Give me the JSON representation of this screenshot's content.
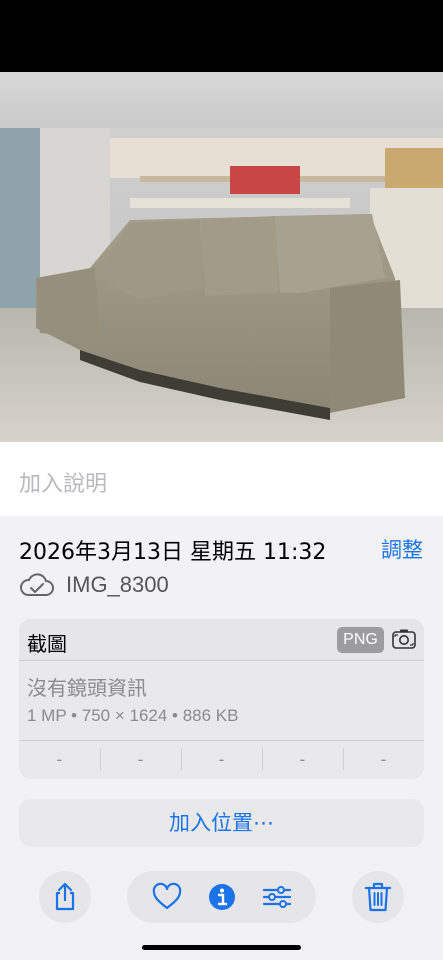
{
  "caption": {
    "placeholder": "加入說明"
  },
  "metadata": {
    "datetime": "2026年3月13日 星期五 11:32",
    "adjust_label": "調整",
    "filename": "IMG_8300",
    "cloud_icon": "icloud-icon"
  },
  "info_card": {
    "type_label": "截圖",
    "format_badge": "PNG",
    "type_icon": "screenshot-camera-icon",
    "lens_info": "沒有鏡頭資訊",
    "specs": "1 MP • 750 × 1624 • 886 KB",
    "exif": [
      "-",
      "-",
      "-",
      "-",
      "-"
    ]
  },
  "add_location_label": "加入位置⋯",
  "toolbar": {
    "share_icon": "share-icon",
    "favorite_icon": "heart-icon",
    "info_icon": "info-icon",
    "edit_icon": "adjust-sliders-icon",
    "delete_icon": "trash-icon"
  },
  "colors": {
    "accent": "#1a73e8",
    "card_bg": "#e9e9ec",
    "badge_bg": "#9c9ca1"
  }
}
